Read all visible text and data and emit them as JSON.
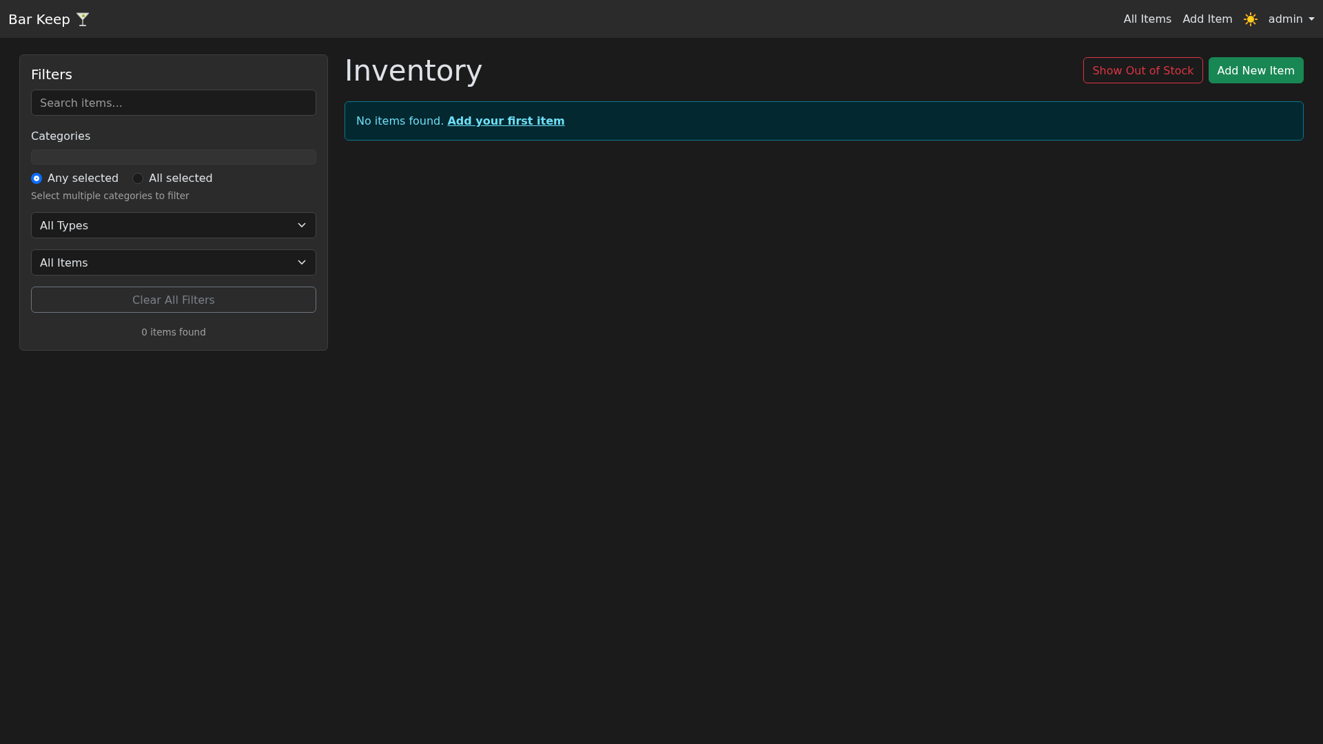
{
  "navbar": {
    "brand": "Bar Keep",
    "links": [
      "All Items",
      "Add Item"
    ],
    "user": "admin"
  },
  "filters": {
    "title": "Filters",
    "search": {
      "placeholder": "Search items..."
    },
    "categories_label": "Categories",
    "match_modes": [
      {
        "label": "Any selected",
        "selected": true
      },
      {
        "label": "All selected",
        "selected": false
      }
    ],
    "hint": "Select multiple categories to filter",
    "selects": [
      {
        "value": "All Types"
      },
      {
        "value": "All Items"
      }
    ],
    "clear_button": "Clear All Filters",
    "count": "0 items found"
  },
  "main": {
    "title": "Inventory",
    "buttons": [
      {
        "label": "Show Out of Stock",
        "kind": "outline-danger"
      },
      {
        "label": "Add New Item",
        "kind": "success"
      }
    ],
    "alert": {
      "text": "No items found.",
      "link": "Add your first item"
    }
  }
}
